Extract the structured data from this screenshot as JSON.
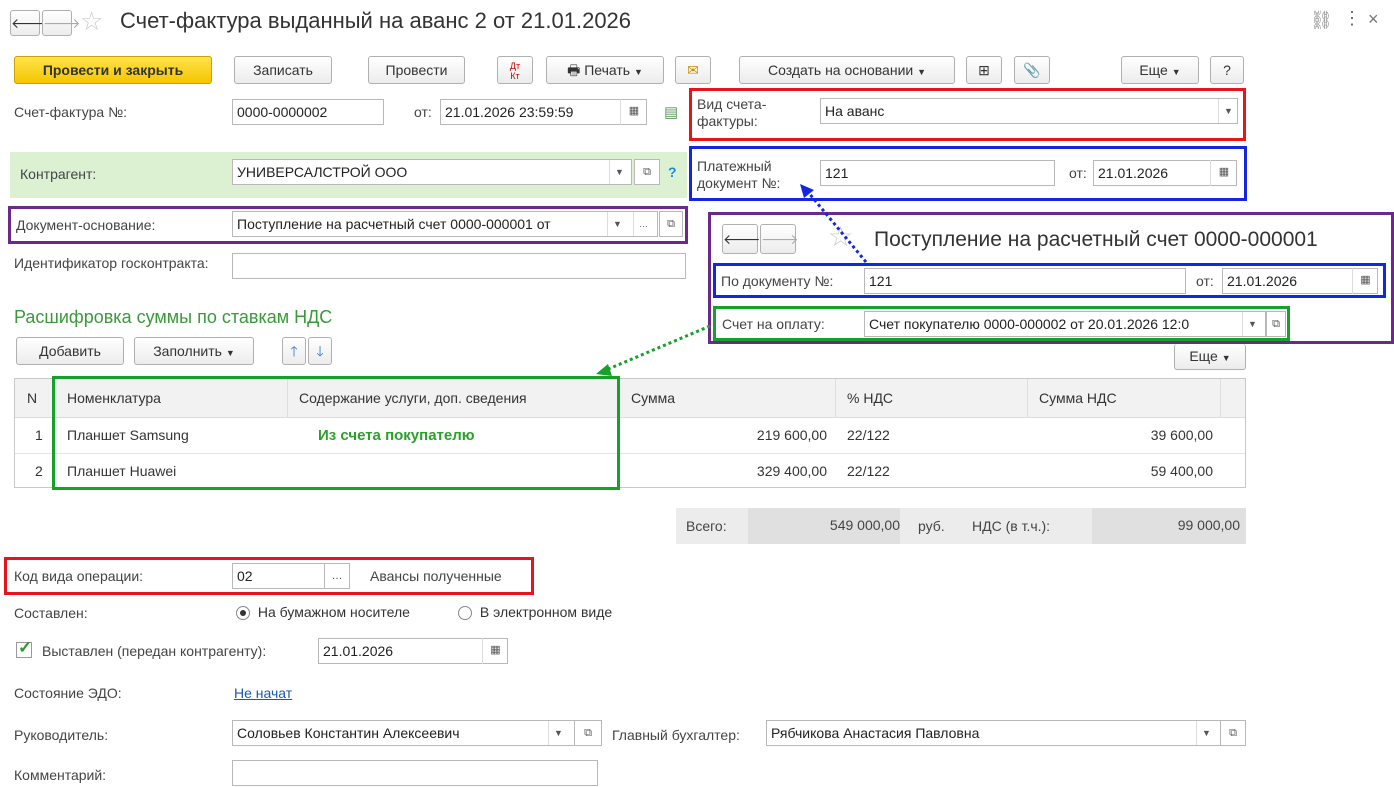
{
  "window": {
    "title": "Счет-фактура выданный на аванс 2 от 21.01.2026",
    "back_icon": "arrow-left-icon",
    "forward_icon": "arrow-right-icon",
    "star_icon": "star-icon",
    "link_icon": "link-icon",
    "menu_icon": "more-vertical-icon",
    "close_icon": "×"
  },
  "toolbar": {
    "post_close": "Провести и закрыть",
    "save": "Записать",
    "post": "Провести",
    "dt_kt": "Дт Кт",
    "print": "Печать",
    "create_based": "Создать на основании",
    "more": "Еще",
    "help": "?"
  },
  "header": {
    "invoice_label": "Счет-фактура №:",
    "invoice_number": "0000-0000002",
    "from_label": "от:",
    "invoice_datetime": "21.01.2026 23:59:59",
    "kind_label": "Вид счета-фактуры:",
    "kind_value": "На аванс",
    "counterparty_label": "Контрагент:",
    "counterparty_value": "УНИВЕРСАЛСТРОЙ ООО",
    "help_mark": "?",
    "payment_doc_label": "Платежный документ №:",
    "payment_doc_number": "121",
    "payment_doc_from_label": "от:",
    "payment_doc_date": "21.01.2026",
    "basis_label": "Документ-основание:",
    "basis_value": "Поступление на расчетный счет 0000-000001 от",
    "gov_contract_label": "Идентификатор госконтракта:",
    "gov_contract_value": ""
  },
  "popup": {
    "title": "Поступление на расчетный счет 0000-000001",
    "doc_no_label": "По документу №:",
    "doc_no_value": "121",
    "from_label": "от:",
    "from_value": "21.01.2026",
    "invoice_label": "Счет на оплату:",
    "invoice_value": "Счет покупателю 0000-000002 от 20.01.2026 12:0"
  },
  "vat_section": {
    "title": "Расшифровка суммы по ставкам НДС",
    "add": "Добавить",
    "fill": "Заполнить",
    "more": "Еще",
    "columns": [
      "N",
      "Номенклатура",
      "Содержание услуги, доп. сведения",
      "Сумма",
      "% НДС",
      "Сумма НДС"
    ],
    "rows": [
      {
        "n": "1",
        "item": "Планшет Samsung",
        "content": "",
        "sum": "219 600,00",
        "rate": "22/122",
        "vat": "39 600,00"
      },
      {
        "n": "2",
        "item": "Планшет Huawei",
        "content": "",
        "sum": "329 400,00",
        "rate": "22/122",
        "vat": "59 400,00"
      }
    ],
    "annotation": "Из счета покупателю",
    "total_label": "Всего:",
    "total_value": "549 000,00",
    "currency": "руб.",
    "vat_total_label": "НДС (в т.ч.):",
    "vat_total_value": "99 000,00"
  },
  "footer": {
    "op_code_label": "Код вида операции:",
    "op_code_value": "02",
    "op_code_desc": "Авансы полученные",
    "composed_label": "Составлен:",
    "paper": "На бумажном носителе",
    "electronic": "В электронном виде",
    "issued_label": "Выставлен (передан контрагенту):",
    "issued_date": "21.01.2026",
    "edo_label": "Состояние ЭДО:",
    "edo_value": "Не начат",
    "manager_label": "Руководитель:",
    "manager_value": "Соловьев Константин Алексеевич",
    "accountant_label": "Главный бухгалтер:",
    "accountant_value": "Рябчикова Анастасия Павловна",
    "comment_label": "Комментарий:",
    "comment_value": ""
  },
  "colors": {
    "red": "#e8141c",
    "blue": "#1427e0",
    "green": "#17a02a",
    "purple": "#6a2a8c",
    "yellow": "#f5c500"
  }
}
